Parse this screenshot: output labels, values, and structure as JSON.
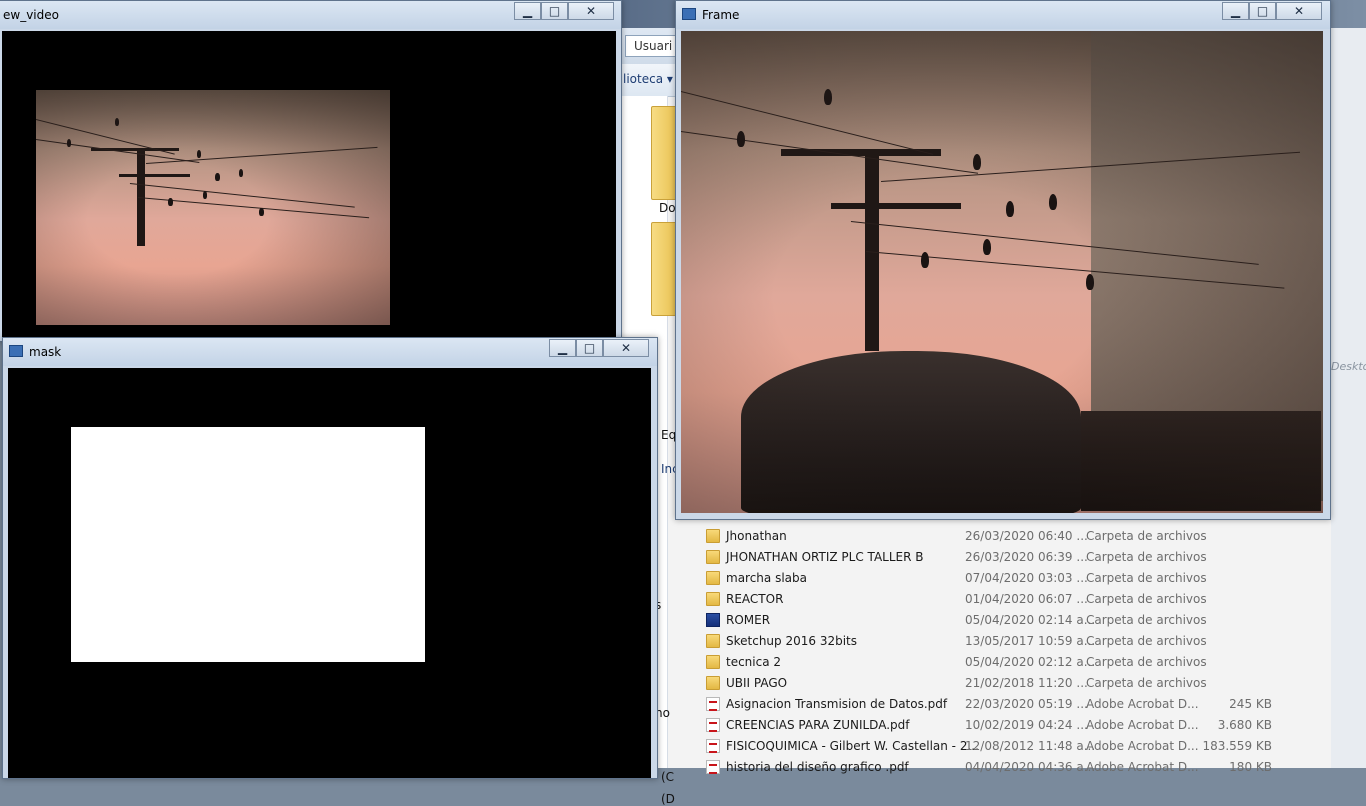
{
  "explorer": {
    "address_text": "Usuari",
    "toolbar_library": "lioteca ▾",
    "side_items": [
      "Do"
    ],
    "partial_labels": [
      "Eq",
      "Inc",
      "(C",
      "(D",
      "s",
      "no"
    ],
    "right_edge_label": "Desktop",
    "files": [
      {
        "name": "Jhonathan",
        "date": "26/03/2020 06:40 ...",
        "type": "Carpeta de archivos",
        "size": "",
        "icon": "folder-icon"
      },
      {
        "name": "JHONATHAN ORTIZ PLC TALLER B",
        "date": "26/03/2020 06:39 ...",
        "type": "Carpeta de archivos",
        "size": "",
        "icon": "folder-icon"
      },
      {
        "name": "marcha slaba",
        "date": "07/04/2020 03:03 ...",
        "type": "Carpeta de archivos",
        "size": "",
        "icon": "folder-icon"
      },
      {
        "name": "REACTOR",
        "date": "01/04/2020 06:07 ...",
        "type": "Carpeta de archivos",
        "size": "",
        "icon": "folder-icon"
      },
      {
        "name": "ROMER",
        "date": "05/04/2020 02:14 a...",
        "type": "Carpeta de archivos",
        "size": "",
        "icon": "app-icon"
      },
      {
        "name": "Sketchup 2016 32bits",
        "date": "13/05/2017 10:59 a...",
        "type": "Carpeta de archivos",
        "size": "",
        "icon": "folder-icon"
      },
      {
        "name": "tecnica 2",
        "date": "05/04/2020 02:12 a...",
        "type": "Carpeta de archivos",
        "size": "",
        "icon": "folder-icon"
      },
      {
        "name": "UBII PAGO",
        "date": "21/02/2018 11:20 ...",
        "type": "Carpeta de archivos",
        "size": "",
        "icon": "folder-icon"
      },
      {
        "name": "Asignacion Transmision de Datos.pdf",
        "date": "22/03/2020 05:19 ...",
        "type": "Adobe Acrobat D...",
        "size": "245 KB",
        "icon": "pdf-icon"
      },
      {
        "name": "CREENCIAS PARA ZUNILDA.pdf",
        "date": "10/02/2019 04:24 ...",
        "type": "Adobe Acrobat D...",
        "size": "3.680 KB",
        "icon": "pdf-icon"
      },
      {
        "name": "FISICOQUIMICA - Gilbert W. Castellan - 2...",
        "date": "12/08/2012 11:48 a...",
        "type": "Adobe Acrobat D...",
        "size": "183.559 KB",
        "icon": "pdf-icon"
      },
      {
        "name": "historia del diseño grafico .pdf",
        "date": "04/04/2020 04:36 a...",
        "type": "Adobe Acrobat D...",
        "size": "180 KB",
        "icon": "pdf-icon"
      }
    ]
  },
  "windows": {
    "new_video": {
      "title": "ew_video"
    },
    "mask": {
      "title": "mask"
    },
    "frame": {
      "title": "Frame"
    }
  },
  "controls": {
    "minimize": "▁",
    "maximize": "□",
    "close": "✕"
  },
  "colors": {
    "titlebar": "#cbd8e8",
    "mask_fg": "#ffffff",
    "mask_bg": "#000000"
  }
}
